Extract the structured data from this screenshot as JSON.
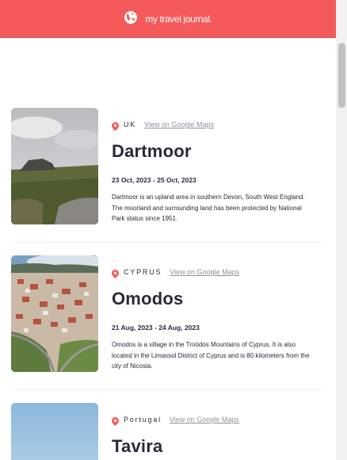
{
  "header": {
    "title": "my travel journal.",
    "logo_icon": "globe-icon",
    "background": "#f55a5a"
  },
  "link_label": "View on Google Maps",
  "entries": [
    {
      "country": "UK",
      "place": "Dartmoor",
      "dates": "23 Oct, 2023 - 25 Oct, 2023",
      "description": "Dartmoor is an upland area in southern Devon, South West England. The moorland and surrounding land has been protected by National Park status since 1951."
    },
    {
      "country": "CYPRUS",
      "place": "Omodos",
      "dates": "21 Aug, 2023 - 24 Aug, 2023",
      "description": "Omodos is a village in the Troödos Mountains of Cyprus. It is also located in the Limassol District of Cyprus and is 80 kilometers from the city of Nicosia."
    },
    {
      "country": "Portugal",
      "place": "Tavira",
      "dates": "",
      "description": ""
    }
  ]
}
